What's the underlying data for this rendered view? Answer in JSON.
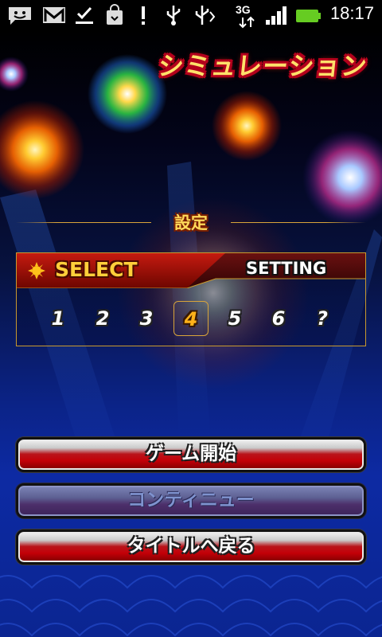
{
  "status_bar": {
    "time": "18:17",
    "network": "3G",
    "icons": [
      "talk-icon",
      "gmail-icon",
      "download-complete-icon",
      "market-icon",
      "warning-icon",
      "usb-icon",
      "usb-debug-icon",
      "signal-icon",
      "battery-icon"
    ]
  },
  "screen": {
    "title": "シミュレーション",
    "section_label": "設定"
  },
  "panel": {
    "select_label": "SELECT",
    "setting_label": "SETTING",
    "options": [
      "1",
      "2",
      "3",
      "4",
      "5",
      "6",
      "?"
    ],
    "selected": "4"
  },
  "buttons": {
    "start": "ゲーム開始",
    "continue": "コンティニュー",
    "back_to_title": "タイトルへ戻る"
  },
  "colors": {
    "accent_gold": "#ffcf3a",
    "button_red": "#c30008",
    "background_blue": "#0d2aa3"
  }
}
